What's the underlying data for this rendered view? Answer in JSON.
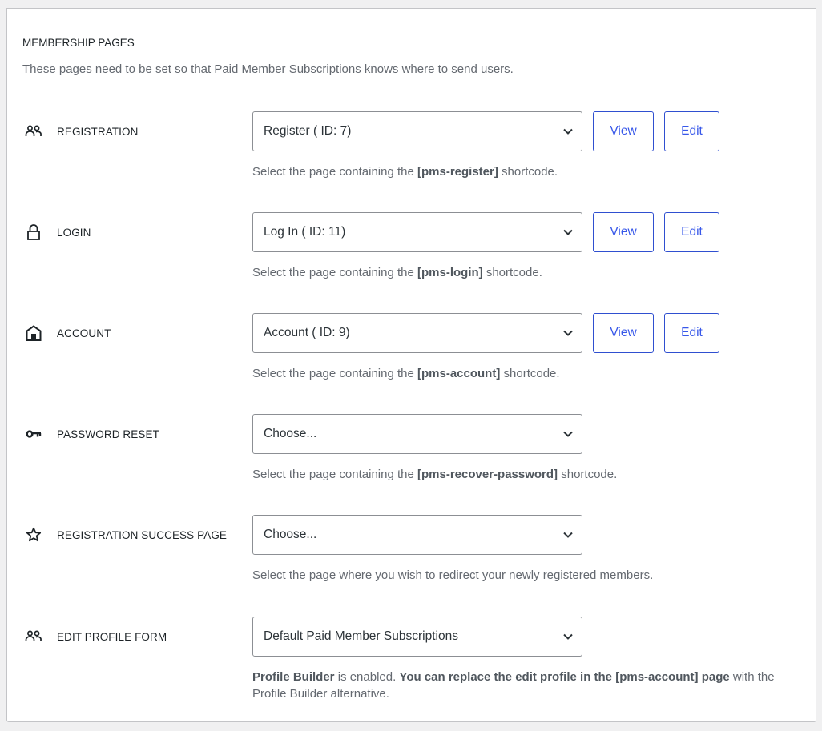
{
  "section": {
    "title": "MEMBERSHIP PAGES",
    "description": "These pages need to be set so that Paid Member Subscriptions knows where to send users."
  },
  "colors": {
    "accent": "#3858e9",
    "text": "#1d2327",
    "muted": "#646970",
    "border": "#8c8f94",
    "background": "#f0f0f1"
  },
  "rows": [
    {
      "label": "REGISTRATION",
      "icon": "users-icon",
      "selected": "Register ( ID: 7)",
      "view_label": "View",
      "edit_label": "Edit",
      "help_pre": "Select the page containing the ",
      "help_code": "[pms-register]",
      "help_post": " shortcode."
    },
    {
      "label": "LOGIN",
      "icon": "lock-icon",
      "selected": "Log In ( ID: 11)",
      "view_label": "View",
      "edit_label": "Edit",
      "help_pre": "Select the page containing the ",
      "help_code": "[pms-login]",
      "help_post": " shortcode."
    },
    {
      "label": "ACCOUNT",
      "icon": "home-icon",
      "selected": "Account ( ID: 9)",
      "view_label": "View",
      "edit_label": "Edit",
      "help_pre": "Select the page containing the ",
      "help_code": "[pms-account]",
      "help_post": " shortcode."
    },
    {
      "label": "PASSWORD RESET",
      "icon": "key-icon",
      "selected": "Choose...",
      "help_pre": "Select the page containing the ",
      "help_code": "[pms-recover-password]",
      "help_post": " shortcode."
    },
    {
      "label": "REGISTRATION SUCCESS PAGE",
      "icon": "star-icon",
      "selected": "Choose...",
      "help_text": "Select the page where you wish to redirect your newly registered members."
    },
    {
      "label": "EDIT PROFILE FORM",
      "icon": "users-icon",
      "selected": "Default Paid Member Subscriptions",
      "help_b1": "Profile Builder",
      "help_t1": " is enabled. ",
      "help_b2": "You can replace the edit profile in the [pms-account] page",
      "help_t2": " with the Profile Builder alternative."
    }
  ]
}
